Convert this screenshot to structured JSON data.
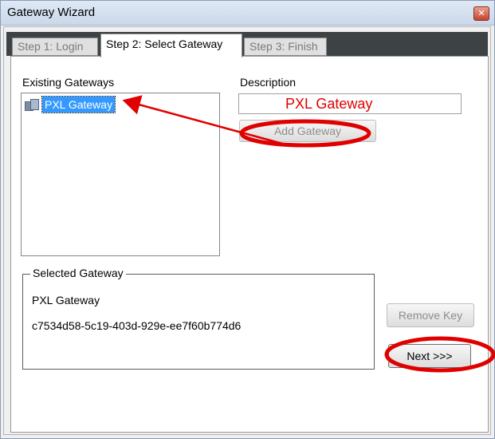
{
  "window": {
    "title": "Gateway Wizard",
    "close_glyph": "✕"
  },
  "tabs": [
    {
      "label": "Step 1: Login",
      "state": "inactive"
    },
    {
      "label": "Step 2: Select Gateway",
      "state": "active"
    },
    {
      "label": "Step 3: Finish",
      "state": "inactive"
    }
  ],
  "existing_gateways": {
    "label": "Existing Gateways",
    "items": [
      {
        "label": "PXL Gateway",
        "selected": true,
        "icon": "gateway-icon"
      }
    ]
  },
  "description": {
    "label": "Description",
    "value": "PXL Gateway"
  },
  "buttons": {
    "add_gateway": "Add Gateway",
    "remove_key": "Remove Key",
    "next": "Next >>>"
  },
  "selected_gateway": {
    "title": "Selected Gateway",
    "name": "PXL Gateway",
    "key": "c7534d58-5c19-403d-929e-ee7f60b774d6"
  },
  "colors": {
    "annotation": "#e00000",
    "selection": "#3399ff",
    "tabstrip": "#3d4245"
  }
}
